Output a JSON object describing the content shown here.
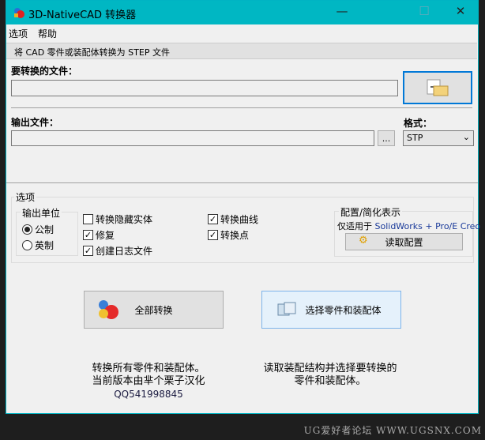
{
  "window": {
    "title": "3D-NativeCAD 转换器",
    "minimize": "—",
    "maximize": "☐",
    "close": "✕"
  },
  "menu": [
    "选项",
    "帮助"
  ],
  "banner": "将 CAD 零件或装配体转换为 STEP 文件",
  "input_file": {
    "label": "要转换的文件：",
    "value": ""
  },
  "output_file": {
    "label": "输出文件：",
    "value": "",
    "browse": "..."
  },
  "format": {
    "label": "格式：",
    "selected": "STP"
  },
  "options": {
    "title": "选项",
    "units": {
      "title": "输出单位",
      "metric": "公制",
      "imperial": "英制",
      "selected": "metric"
    },
    "checkboxes": [
      {
        "label": "转换隐藏实体",
        "checked": false
      },
      {
        "label": "修复",
        "checked": true
      },
      {
        "label": "创建日志文件",
        "checked": true
      },
      {
        "label": "转换曲线",
        "checked": true
      },
      {
        "label": "转换点",
        "checked": true
      }
    ],
    "config": {
      "title": "配置/简化表示",
      "note_prefix": "仅适用于 ",
      "note_highlight": "SolidWorks + Pro/E Creo",
      "button": "读取配置"
    }
  },
  "actions": {
    "convert_all": "全部转换",
    "select_parts": "选择零件和装配体"
  },
  "descriptions": {
    "left": [
      "转换所有零件和装配体。",
      "当前版本由芈个栗子汉化",
      "QQ541998845"
    ],
    "right": [
      "读取装配结构并选择要转换的",
      "零件和装配体。"
    ]
  },
  "watermark": "UG爱好者论坛 WWW.UGSNX.COM",
  "colors": {
    "titlebar": "#00b7c3",
    "focus": "#0078d7",
    "link": "#1a3a9a"
  }
}
